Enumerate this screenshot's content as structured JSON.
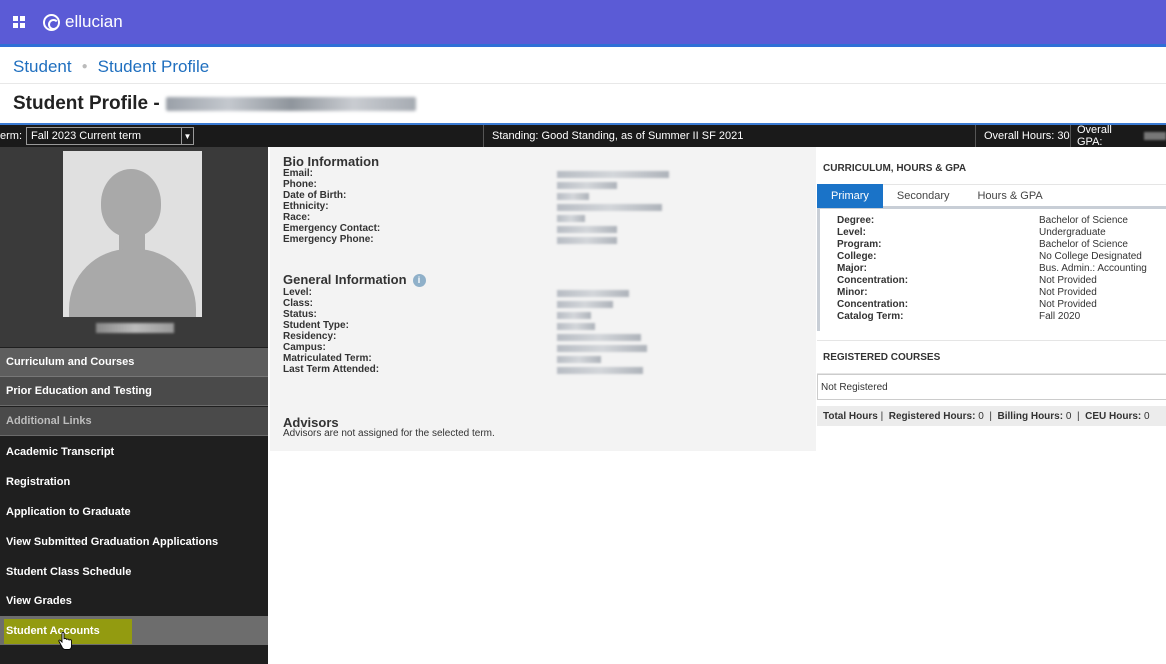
{
  "header": {
    "brand": "ellucian"
  },
  "breadcrumb": {
    "root": "Student",
    "current": "Student Profile"
  },
  "page": {
    "title": "Student Profile -"
  },
  "termbar": {
    "term_label": "erm:",
    "term_value": "Fall 2023 Current term",
    "standing": "Standing: Good Standing, as of Summer II SF 2021",
    "overall_hours": "Overall Hours: 30",
    "overall_gpa_label": "Overall GPA:"
  },
  "sidebar": {
    "items": [
      {
        "label": "Curriculum and Courses"
      },
      {
        "label": "Prior Education and Testing"
      },
      {
        "label": "Additional Links"
      },
      {
        "label": "Academic Transcript"
      },
      {
        "label": "Registration"
      },
      {
        "label": "Application to Graduate"
      },
      {
        "label": "View Submitted Graduation Applications"
      },
      {
        "label": "Student Class Schedule"
      },
      {
        "label": "View Grades"
      },
      {
        "label": "Student Accounts"
      }
    ]
  },
  "bio": {
    "title": "Bio Information",
    "fields": [
      "Email:",
      "Phone:",
      "Date of Birth:",
      "Ethnicity:",
      "Race:",
      "Emergency Contact:",
      "Emergency Phone:"
    ]
  },
  "general": {
    "title": "General Information",
    "fields": [
      "Level:",
      "Class:",
      "Status:",
      "Student Type:",
      "Residency:",
      "Campus:",
      "Matriculated Term:",
      "Last Term Attended:"
    ]
  },
  "advisors": {
    "title": "Advisors",
    "text": "Advisors are not assigned for the selected term."
  },
  "curriculum": {
    "title": "CURRICULUM, HOURS & GPA",
    "tabs": [
      "Primary",
      "Secondary",
      "Hours & GPA"
    ],
    "rows": [
      {
        "label": "Degree:",
        "value": "Bachelor of Science"
      },
      {
        "label": "Level:",
        "value": "Undergraduate"
      },
      {
        "label": "Program:",
        "value": "Bachelor of Science"
      },
      {
        "label": "College:",
        "value": "No College Designated"
      },
      {
        "label": "Major:",
        "value": "Bus. Admin.: Accounting"
      },
      {
        "label": "Concentration:",
        "value": "Not Provided"
      },
      {
        "label": "Minor:",
        "value": "Not Provided"
      },
      {
        "label": "Concentration:",
        "value": "Not Provided"
      },
      {
        "label": "Catalog Term:",
        "value": "Fall 2020"
      }
    ]
  },
  "registered": {
    "title": "REGISTERED COURSES",
    "status": "Not Registered",
    "totals": {
      "total_label": "Total Hours",
      "registered_label": "Registered Hours:",
      "registered_value": "0",
      "billing_label": "Billing Hours:",
      "billing_value": "0",
      "ceu_label": "CEU Hours:",
      "ceu_value": "0"
    }
  }
}
